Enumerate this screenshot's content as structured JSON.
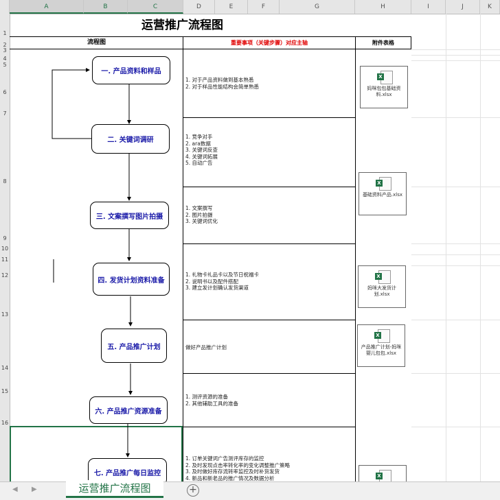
{
  "columns": [
    "A",
    "B",
    "C",
    "D",
    "E",
    "F",
    "G",
    "H",
    "I",
    "J",
    "K"
  ],
  "rows": [
    "1",
    "2",
    "3",
    "4",
    "5",
    "6",
    "7",
    "8",
    "9",
    "10",
    "11",
    "12",
    "13",
    "14",
    "15",
    "16"
  ],
  "sheet": {
    "title": "运营推广流程图",
    "header_flow": "流程图",
    "header_items": "重要事项（关键步骤）对应主轴",
    "header_attach": "附件表格",
    "nodes": [
      "一. 产品资料和样品",
      "二. 关键词调研",
      "三. 文案撰写图片拍摄",
      "四. 发货计划资料准备",
      "五. 产品推广计划",
      "六. 产品推广资源准备",
      "七. 产品推广每日监控"
    ],
    "descriptions": [
      "1. 对于产品资料做到基本熟悉\n2. 对于样品性能结构会简单熟悉",
      "1. 竞争对手\n2. ara数据\n3. 关键词反查\n4. 关键词拓展\n5. 自动广告",
      "1. 文案撰写\n2. 图片拍摄\n3. 关键词优化",
      "1. 礼物卡礼品卡以及节日祝福卡\n2. 说明书以及配件搭配\n3. 建立发计划确认发货渠道",
      "做好产品推广计划",
      "1. 测评资源的准备\n2. 其他辅助工具的准备",
      "1. 订单关键词广告测评库存的监控\n2. 及时发现点击率转化率的变化调整推广策略\n3. 及时做好库存流转率监控及时补货发货\n4. 新品和新老品的推广情况及数据分析"
    ],
    "attachments": [
      "妈咪包包基础资料.xlsx",
      "基础资料产品.xlsx",
      "妈咪大发货计划.xlsx",
      "产品推广计划-妈咪婴儿包包.xlsx",
      ""
    ]
  },
  "tabs": {
    "active": "运营推广流程图",
    "add": "+"
  },
  "nav": {
    "prev": "◀",
    "next": "▶"
  },
  "icons": {
    "file": "excel-file-icon",
    "xl_letter": "X"
  }
}
